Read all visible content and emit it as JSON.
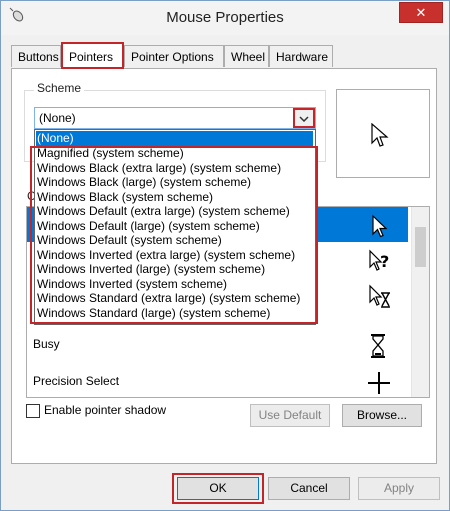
{
  "window": {
    "title": "Mouse Properties",
    "close_symbol": "✕"
  },
  "tabs": [
    {
      "label": "Buttons"
    },
    {
      "label": "Pointers"
    },
    {
      "label": "Pointer Options"
    },
    {
      "label": "Wheel"
    },
    {
      "label": "Hardware"
    }
  ],
  "active_tab": "Pointers",
  "scheme": {
    "group_label": "Scheme",
    "current_value": "(None)",
    "options": [
      "(None)",
      "Magnified (system scheme)",
      "Windows Black (extra large) (system scheme)",
      "Windows Black (large) (system scheme)",
      "Windows Black (system scheme)",
      "Windows Default (extra large) (system scheme)",
      "Windows Default (large) (system scheme)",
      "Windows Default (system scheme)",
      "Windows Inverted (extra large) (system scheme)",
      "Windows Inverted (large) (system scheme)",
      "Windows Inverted (system scheme)",
      "Windows Standard (extra large) (system scheme)",
      "Windows Standard (large) (system scheme)"
    ]
  },
  "customize": {
    "label": "C",
    "rows": [
      {
        "label": "",
        "icon": "arrow-cursor-icon",
        "selected": true
      },
      {
        "label": "",
        "icon": "help-select-cursor-icon"
      },
      {
        "label": "",
        "icon": "working-in-background-cursor-icon"
      },
      {
        "label": "Busy",
        "icon": "hourglass-cursor-icon"
      },
      {
        "label": "Precision Select",
        "icon": "crosshair-cursor-icon"
      }
    ]
  },
  "shadow": {
    "label": "Enable pointer shadow",
    "checked": false
  },
  "buttons": {
    "use_default": "Use Default",
    "browse": "Browse...",
    "ok": "OK",
    "cancel": "Cancel",
    "apply": "Apply"
  },
  "colors": {
    "accent": "#0078d7",
    "highlight_frame": "#c4252a",
    "close_button": "#c7302d"
  }
}
